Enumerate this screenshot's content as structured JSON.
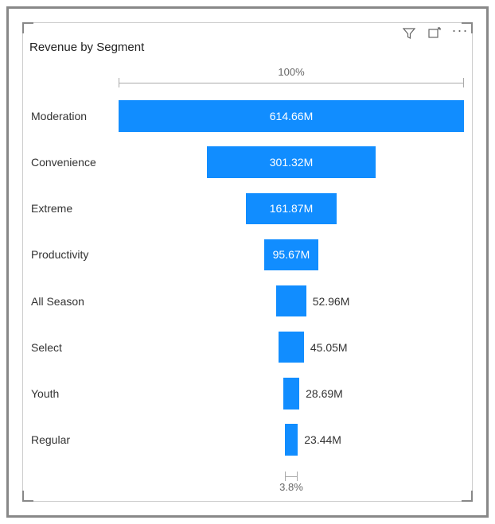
{
  "title": "Revenue by Segment",
  "toolbar": {
    "filter_icon": "filter",
    "focus_icon": "focus-mode",
    "more_icon": "more"
  },
  "scale": {
    "top_label": "100%",
    "bottom_label": "3.8%"
  },
  "colors": {
    "bar": "#118DFF"
  },
  "chart_data": {
    "type": "bar",
    "title": "Revenue by Segment",
    "xlabel": "",
    "ylabel": "",
    "categories": [
      "Moderation",
      "Convenience",
      "Extreme",
      "Productivity",
      "All Season",
      "Select",
      "Youth",
      "Regular"
    ],
    "values": [
      614.66,
      301.32,
      161.87,
      95.67,
      52.96,
      45.05,
      28.69,
      23.44
    ],
    "value_labels": [
      "614.66M",
      "301.32M",
      "161.87M",
      "95.67M",
      "52.96M",
      "45.05M",
      "28.69M",
      "23.44M"
    ],
    "top_percent": "100%",
    "bottom_percent": "3.8%"
  }
}
